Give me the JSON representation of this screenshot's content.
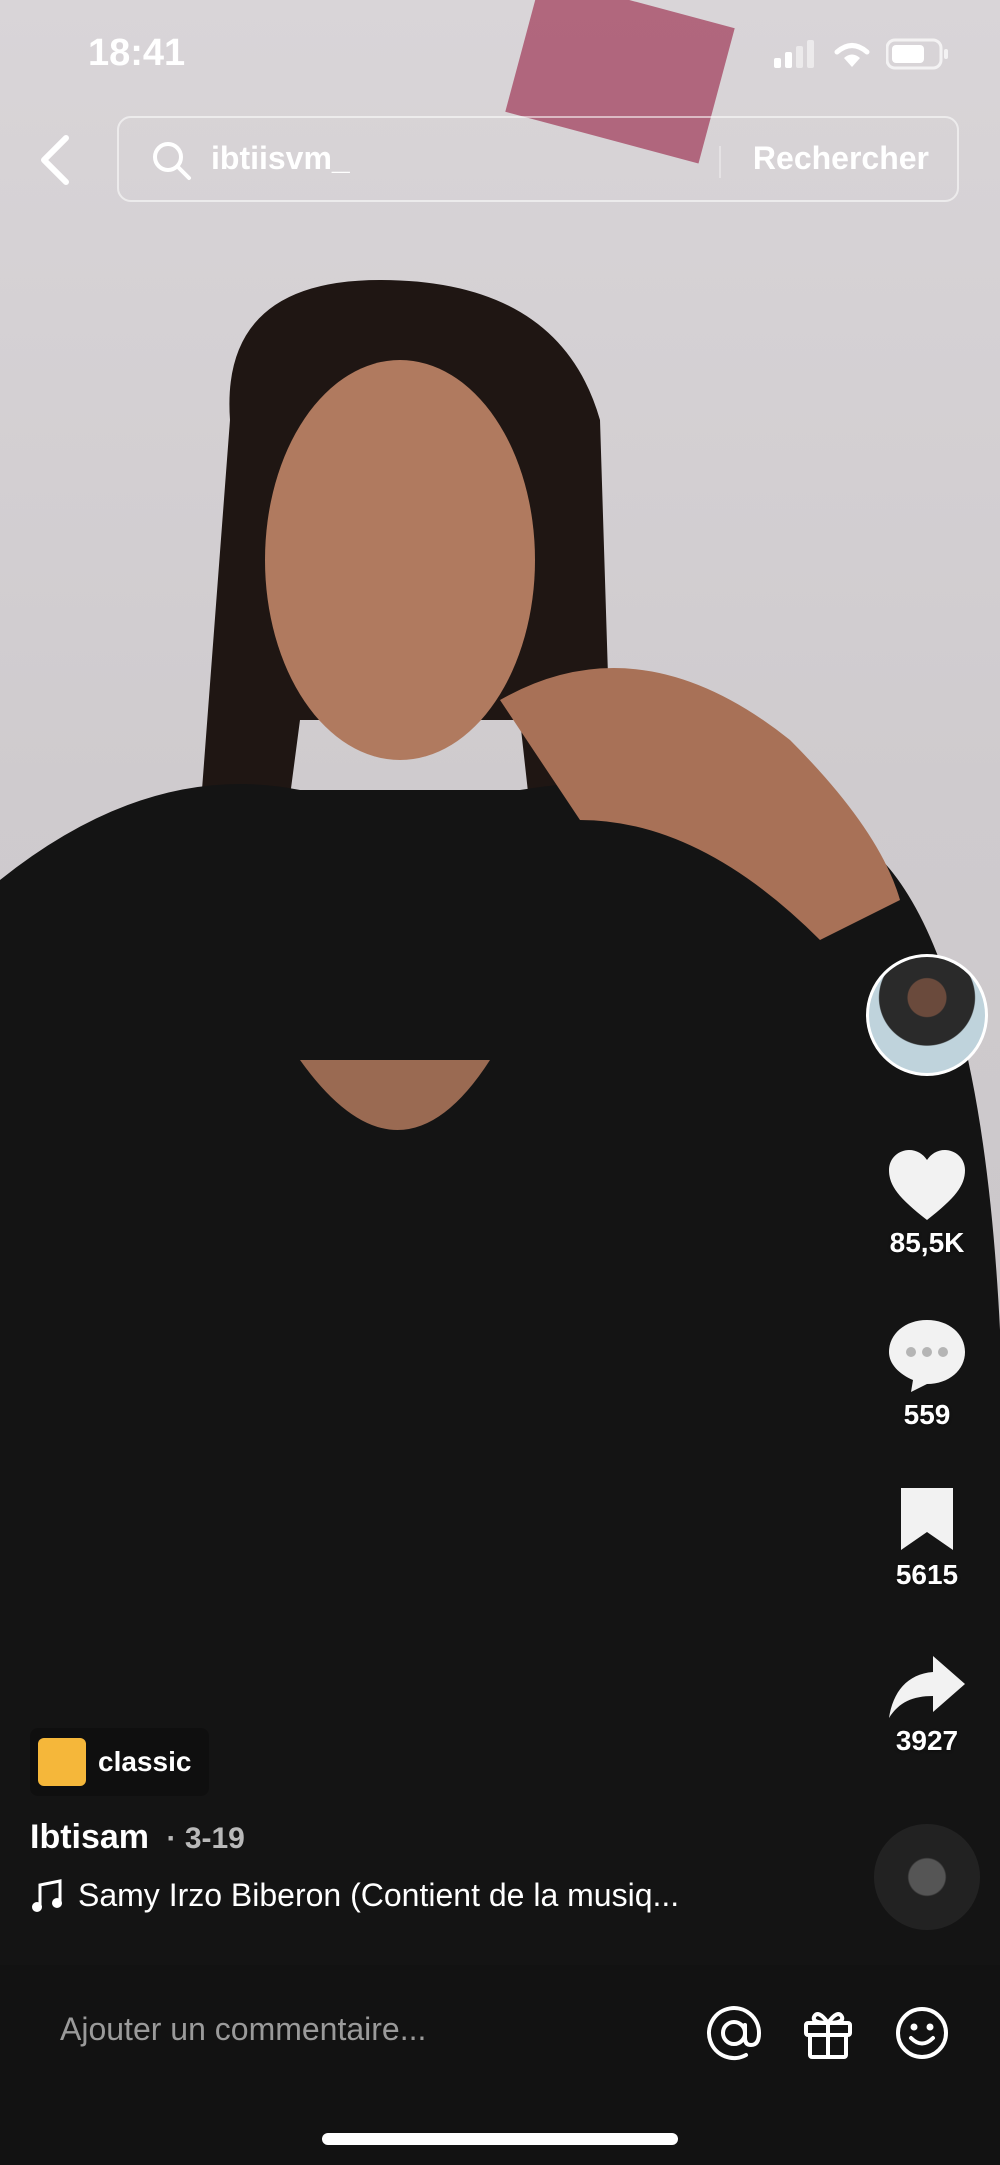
{
  "status_bar": {
    "time": "18:41"
  },
  "search": {
    "query": "ibtiisvm_",
    "button_label": "Rechercher"
  },
  "actions": {
    "likes": "85,5K",
    "comments": "559",
    "saves": "5615",
    "shares": "3927"
  },
  "video_info": {
    "tag_label": "classic",
    "author": "Ibtisam",
    "date": "· 3-19",
    "music": "Samy Irzo Biberon (Contient de la musiq..."
  },
  "comment_bar": {
    "placeholder": "Ajouter un commentaire..."
  },
  "colors": {
    "tag_icon": "#f5b73a",
    "comment_bar_bg": "#121212"
  }
}
